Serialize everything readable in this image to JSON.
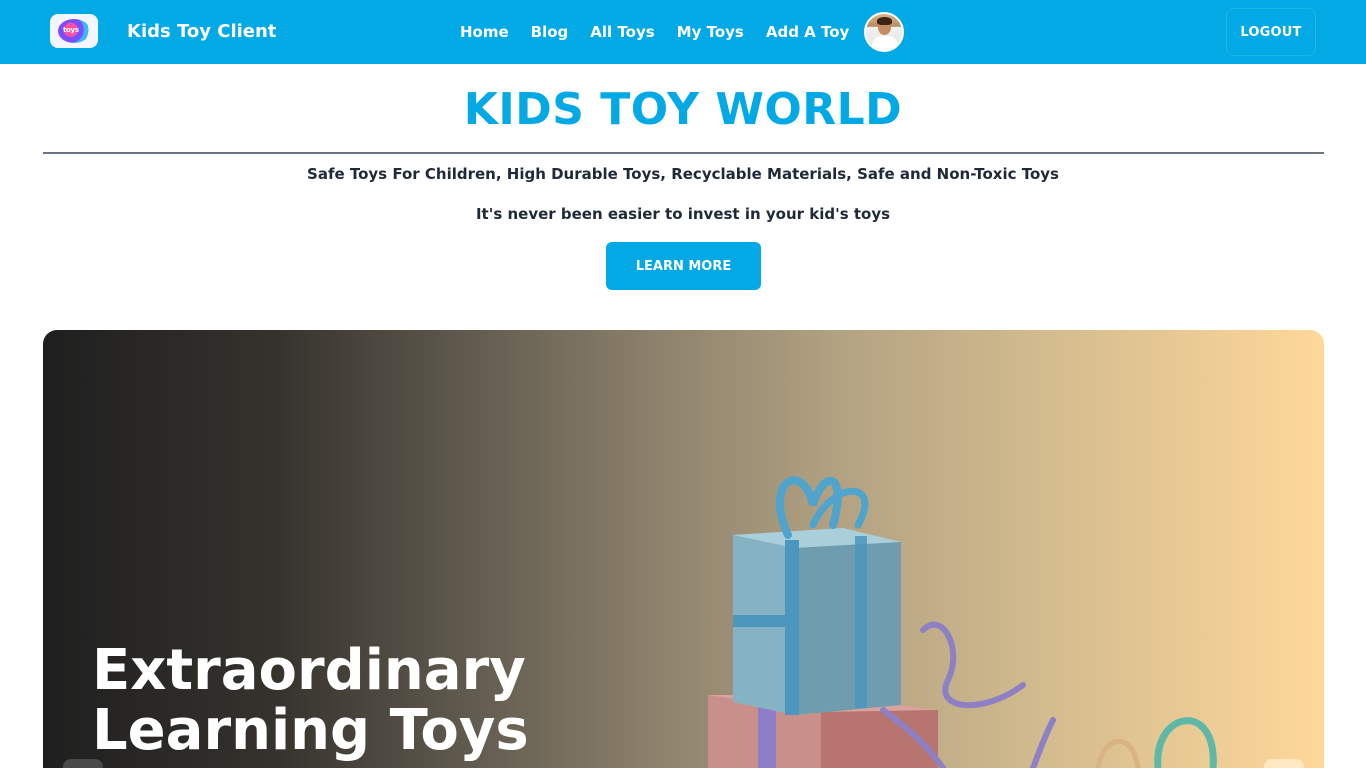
{
  "navbar": {
    "brand_title": "Kids Toy Client",
    "logo_text": "toys",
    "links": [
      "Home",
      "Blog",
      "All Toys",
      "My Toys",
      "Add A Toy"
    ],
    "logout_label": "LOGOUT",
    "background_color": "#03a9e4"
  },
  "hero": {
    "title": "KIDS TOY WORLD",
    "tagline": "Safe Toys For Children, High Durable Toys, Recyclable Materials, Safe and Non-Toxic Toys",
    "subline": "It's never been easier to invest in your kid's toys",
    "button_label": "LEARN MORE"
  },
  "carousel": {
    "heading_line1": "Extraordinary",
    "heading_line2": "Learning Toys",
    "image": "gift-boxes-photo"
  }
}
